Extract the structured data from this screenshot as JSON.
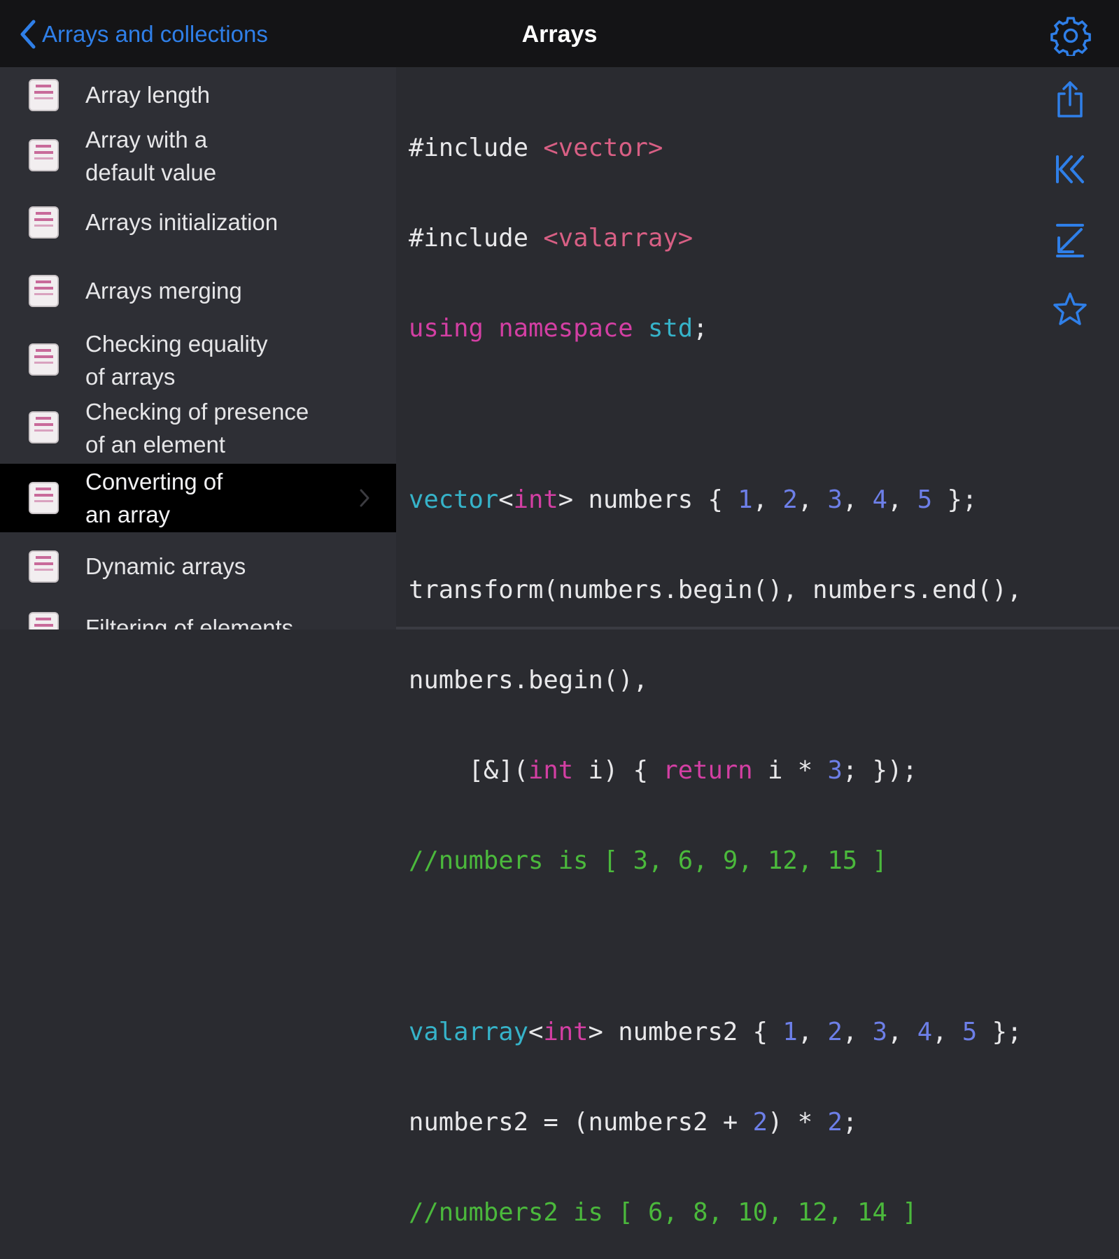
{
  "nav": {
    "back_label": "Arrays and collections",
    "title": "Arrays",
    "settings_icon": "gear-icon"
  },
  "colors": {
    "accent": "#2f7fe8",
    "nav_bg": "#141416",
    "sidebar_bg": "#2e2f35",
    "selected_bg": "#000000",
    "code_bg": "#2a2b30",
    "string": "#d85f84",
    "keyword": "#d33fa3",
    "type": "#36b3c9",
    "number": "#6d7fe8",
    "comment": "#4bb93c"
  },
  "sidebar": {
    "items": [
      {
        "label": "Array length"
      },
      {
        "label": "Array with a\ndefault value"
      },
      {
        "label": "Arrays initialization"
      },
      {
        "label": "Arrays merging"
      },
      {
        "label": "Checking equality\nof arrays"
      },
      {
        "label": "Checking of presence\nof an element"
      },
      {
        "label": "Converting of\nan array",
        "selected": true
      },
      {
        "label": "Dynamic arrays"
      },
      {
        "label": "Filtering of elements"
      }
    ]
  },
  "code": {
    "l1": {
      "a": "#include ",
      "b": "<vector>"
    },
    "l2": {
      "a": "#include ",
      "b": "<valarray>"
    },
    "l3": {
      "a": "using namespace ",
      "b": "std",
      "c": ";"
    },
    "l4": {
      "type": "vector",
      "lt": "<",
      "int": "int",
      "rest": "> numbers { ",
      "n1": "1",
      "c1": ", ",
      "n2": "2",
      "c2": ", ",
      "n3": "3",
      "c3": ", ",
      "n4": "4",
      "c4": ", ",
      "n5": "5",
      "end": " };"
    },
    "l5": "transform(numbers.begin(), numbers.end(),",
    "l6": "numbers.begin(),",
    "l7": {
      "a": "    [&](",
      "int": "int",
      "b": " i) { ",
      "ret": "return",
      "c": " i * ",
      "n": "3",
      "d": "; });"
    },
    "l8": "//numbers is [ 3, 6, 9, 12, 15 ]",
    "l9": {
      "type": "valarray",
      "lt": "<",
      "int": "int",
      "rest": "> numbers2 { ",
      "n1": "1",
      "c1": ", ",
      "n2": "2",
      "c2": ", ",
      "n3": "3",
      "c3": ", ",
      "n4": "4",
      "c4": ", ",
      "n5": "5",
      "end": " };"
    },
    "l10": {
      "a": "numbers2 = (numbers2 + ",
      "n1": "2",
      "b": ") * ",
      "n2": "2",
      "c": ";"
    },
    "l11": "//numbers2 is [ 6, 8, 10, 12, 14 ]"
  },
  "toolbar": {
    "share_icon": "share-icon",
    "first_icon": "jump-to-first-icon",
    "last_icon": "jump-to-last-icon",
    "favorite_icon": "star-icon"
  }
}
